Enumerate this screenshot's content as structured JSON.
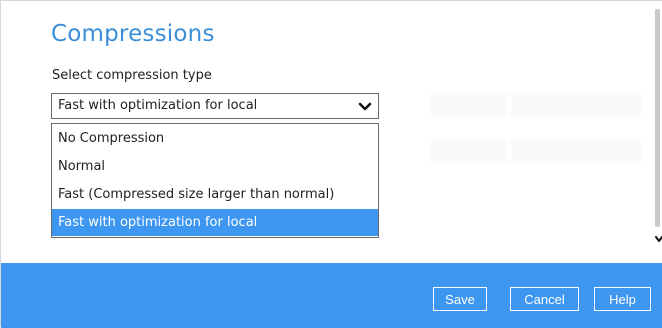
{
  "panel": {
    "title": "Compressions",
    "select_label": "Select compression type"
  },
  "compression_select": {
    "value": "Fast with optimization for local",
    "options": [
      {
        "label": "No Compression",
        "selected": false
      },
      {
        "label": "Normal",
        "selected": false
      },
      {
        "label": "Fast (Compressed size larger than normal)",
        "selected": false
      },
      {
        "label": "Fast with optimization for local",
        "selected": true
      }
    ]
  },
  "footer": {
    "save_label": "Save",
    "cancel_label": "Cancel",
    "help_label": "Help"
  },
  "colors": {
    "accent": "#3d96f0",
    "title": "#3a8fd8"
  },
  "icons": {
    "select_arrow": "chevron-down-icon",
    "scroll_arrow": "scroll-down-arrow-icon"
  }
}
